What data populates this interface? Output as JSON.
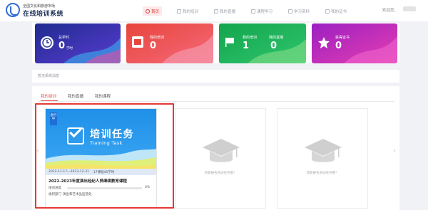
{
  "brand": {
    "subtitle": "全国文化和旅游市场",
    "title": "在线培训系统"
  },
  "nav": [
    {
      "label": "首页",
      "active": true
    },
    {
      "label": "我的培训"
    },
    {
      "label": "我的直播"
    },
    {
      "label": "课程学习"
    },
    {
      "label": "学习资料"
    },
    {
      "label": "我的证书"
    }
  ],
  "user": {
    "welcome": "欢迎您，"
  },
  "stats": [
    {
      "label": "总学时",
      "value": "0",
      "unit": "学时",
      "colors": [
        "#1e2b8f",
        "#5b3cd1"
      ]
    },
    {
      "label": "我的培训",
      "value": "0",
      "colors": [
        "#e8453c",
        "#f46a7a"
      ]
    },
    {
      "label": "我的培训",
      "value": "1",
      "label2": "我的直播",
      "value2": "0",
      "colors": [
        "#14a44d",
        "#2ec66e"
      ]
    },
    {
      "label": "获得证书",
      "value": "0",
      "colors": [
        "#9b1fc2",
        "#e63fb0"
      ]
    }
  ],
  "notice": {
    "text": "暂无系统消息"
  },
  "tabs": [
    {
      "label": "我的培训",
      "active": true
    },
    {
      "label": "我的直播"
    },
    {
      "label": "我的课程"
    }
  ],
  "course": {
    "tag": "进行中",
    "banner_title": "培训任务",
    "banner_subtitle": "Training Task",
    "dates": "2022-11-17—2023-12-31",
    "hours": "17课程45学时",
    "title": "2022-2023年度演出经纪人员继续教育课程",
    "progress_label": "培训进度",
    "progress": "0%",
    "org_label": "组织部门",
    "org": "演出和艺术品监管处"
  },
  "empty_text": "还能报名培训任务哦！",
  "arrows": {
    "left": "‹",
    "right": "›"
  }
}
